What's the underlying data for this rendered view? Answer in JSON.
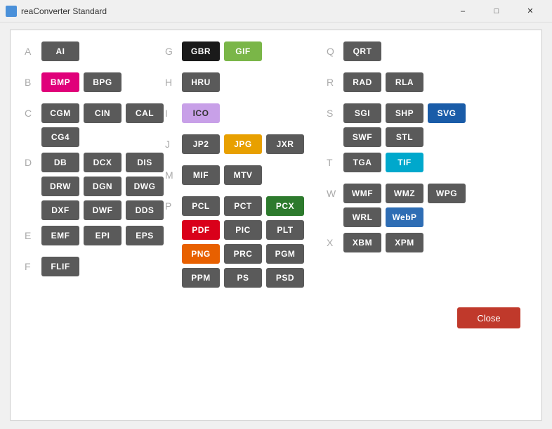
{
  "titleBar": {
    "title": "reaConverter Standard",
    "minimizeLabel": "–",
    "maximizeLabel": "□",
    "closeLabel": "✕"
  },
  "columns": {
    "col1": {
      "sections": [
        {
          "letter": "A",
          "formats": [
            {
              "label": "AI",
              "color": "gray"
            }
          ]
        },
        {
          "letter": "B",
          "formats": [
            {
              "label": "BMP",
              "color": "magenta"
            },
            {
              "label": "BPG",
              "color": "gray"
            }
          ]
        },
        {
          "letter": "C",
          "formats": [
            {
              "label": "CGM",
              "color": "gray"
            },
            {
              "label": "CIN",
              "color": "gray"
            },
            {
              "label": "CAL",
              "color": "gray"
            },
            {
              "label": "CG4",
              "color": "gray"
            }
          ]
        },
        {
          "letter": "D",
          "formats": [
            {
              "label": "DB",
              "color": "gray"
            },
            {
              "label": "DCX",
              "color": "gray"
            },
            {
              "label": "DIS",
              "color": "gray"
            },
            {
              "label": "DRW",
              "color": "gray"
            },
            {
              "label": "DGN",
              "color": "gray"
            },
            {
              "label": "DWG",
              "color": "gray"
            },
            {
              "label": "DXF",
              "color": "gray"
            },
            {
              "label": "DWF",
              "color": "gray"
            },
            {
              "label": "DDS",
              "color": "gray"
            }
          ]
        },
        {
          "letter": "E",
          "formats": [
            {
              "label": "EMF",
              "color": "gray"
            },
            {
              "label": "EPI",
              "color": "gray"
            },
            {
              "label": "EPS",
              "color": "gray"
            }
          ]
        },
        {
          "letter": "F",
          "formats": [
            {
              "label": "FLIF",
              "color": "gray"
            }
          ]
        }
      ]
    },
    "col2": {
      "sections": [
        {
          "letter": "G",
          "formats": [
            {
              "label": "GBR",
              "color": "black"
            },
            {
              "label": "GIF",
              "color": "green"
            }
          ]
        },
        {
          "letter": "H",
          "formats": [
            {
              "label": "HRU",
              "color": "gray"
            }
          ]
        },
        {
          "letter": "I",
          "formats": [
            {
              "label": "ICO",
              "color": "light-purple"
            }
          ]
        },
        {
          "letter": "J",
          "formats": [
            {
              "label": "JP2",
              "color": "gray"
            },
            {
              "label": "JPG",
              "color": "orange"
            },
            {
              "label": "JXR",
              "color": "gray"
            }
          ]
        },
        {
          "letter": "M",
          "formats": [
            {
              "label": "MIF",
              "color": "gray"
            },
            {
              "label": "MTV",
              "color": "gray"
            }
          ]
        },
        {
          "letter": "P",
          "formats": [
            {
              "label": "PCL",
              "color": "gray"
            },
            {
              "label": "PCT",
              "color": "gray"
            },
            {
              "label": "PCX",
              "color": "dark-green"
            },
            {
              "label": "PDF",
              "color": "red"
            },
            {
              "label": "PIC",
              "color": "gray"
            },
            {
              "label": "PLT",
              "color": "gray"
            },
            {
              "label": "PNG",
              "color": "bright-orange"
            },
            {
              "label": "PRC",
              "color": "gray"
            },
            {
              "label": "PGM",
              "color": "gray"
            },
            {
              "label": "PPM",
              "color": "gray"
            },
            {
              "label": "PS",
              "color": "gray"
            },
            {
              "label": "PSD",
              "color": "gray"
            }
          ]
        }
      ]
    },
    "col3": {
      "sections": [
        {
          "letter": "Q",
          "formats": [
            {
              "label": "QRT",
              "color": "gray"
            }
          ]
        },
        {
          "letter": "R",
          "formats": [
            {
              "label": "RAD",
              "color": "gray"
            },
            {
              "label": "RLA",
              "color": "gray"
            }
          ]
        },
        {
          "letter": "S",
          "formats": [
            {
              "label": "SGI",
              "color": "gray"
            },
            {
              "label": "SHP",
              "color": "gray"
            },
            {
              "label": "SVG",
              "color": "svg-blue"
            },
            {
              "label": "SWF",
              "color": "gray"
            },
            {
              "label": "STL",
              "color": "gray"
            }
          ]
        },
        {
          "letter": "T",
          "formats": [
            {
              "label": "TGA",
              "color": "gray"
            },
            {
              "label": "TIF",
              "color": "teal"
            }
          ]
        },
        {
          "letter": "W",
          "formats": [
            {
              "label": "WMF",
              "color": "gray"
            },
            {
              "label": "WMZ",
              "color": "gray"
            },
            {
              "label": "WPG",
              "color": "gray"
            },
            {
              "label": "WRL",
              "color": "gray"
            },
            {
              "label": "WebP",
              "color": "blue"
            }
          ]
        },
        {
          "letter": "X",
          "formats": [
            {
              "label": "XBM",
              "color": "gray"
            },
            {
              "label": "XPM",
              "color": "gray"
            }
          ]
        }
      ]
    }
  },
  "closeButton": "Close"
}
